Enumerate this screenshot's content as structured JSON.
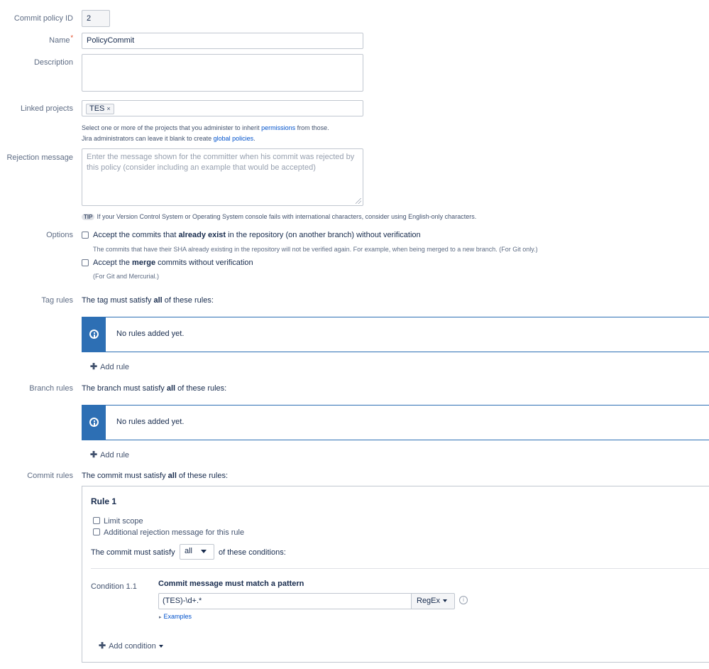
{
  "form": {
    "policy_id": {
      "label": "Commit policy ID",
      "value": "2"
    },
    "name": {
      "label": "Name",
      "required_mark": "*",
      "value": "PolicyCommit"
    },
    "description": {
      "label": "Description",
      "value": ""
    },
    "linked_projects": {
      "label": "Linked projects",
      "chips": [
        "TES"
      ],
      "remove_glyph": "×",
      "help_line1_pre": "Select one or more of the projects that you administer to inherit ",
      "help_line1_link": "permissions",
      "help_line1_post": " from those.",
      "help_line2_pre": "Jira administrators can leave it blank to create ",
      "help_line2_link": "global policies",
      "help_line2_post": "."
    },
    "rejection_message": {
      "label": "Rejection message",
      "placeholder": "Enter the message shown for the committer when his commit was rejected by this policy (consider including an example that would be accepted)",
      "tip_badge": "TIP",
      "tip_text": "If your Version Control System or Operating System console fails with international characters, consider using English-only characters."
    },
    "options": {
      "label": "Options",
      "opt1_pre": "Accept the commits that ",
      "opt1_bold": "already exist",
      "opt1_post": " in the repository (on another branch) without verification",
      "opt1_help": "The commits that have their SHA already existing in the repository will not be verified again. For example, when being merged to a new branch. (For Git only.)",
      "opt2_pre": "Accept the ",
      "opt2_bold": "merge",
      "opt2_post": " commits without verification",
      "opt2_help": "(For Git and Mercurial.)"
    },
    "tag_rules": {
      "label": "Tag rules",
      "intro_pre": "The tag must satisfy ",
      "intro_bold": "all",
      "intro_post": " of these rules:",
      "empty": "No rules added yet.",
      "add": "Add rule"
    },
    "branch_rules": {
      "label": "Branch rules",
      "intro_pre": "The branch must satisfy ",
      "intro_bold": "all",
      "intro_post": " of these rules:",
      "empty": "No rules added yet.",
      "add": "Add rule"
    },
    "commit_rules": {
      "label": "Commit rules",
      "intro_pre": "The commit must satisfy ",
      "intro_bold": "all",
      "intro_post": " of these rules:",
      "rule_title": "Rule 1",
      "limit_scope": "Limit scope",
      "additional_rejection": "Additional rejection message for this rule",
      "satisfy_pre": "The commit must satisfy",
      "satisfy_value": "all",
      "satisfy_post": "of these conditions:",
      "condition_label": "Condition 1.1",
      "condition_title": "Commit message must match a pattern",
      "pattern_value": "(TES)-\\d+.*",
      "pattern_type": "RegEx",
      "info_glyph": "i",
      "examples": "Examples",
      "examples_glyph": "▸",
      "add_condition": "Add condition"
    }
  },
  "colors": {
    "accent": "#2d6fb4",
    "link": "#0052cc",
    "required": "#de350b"
  }
}
